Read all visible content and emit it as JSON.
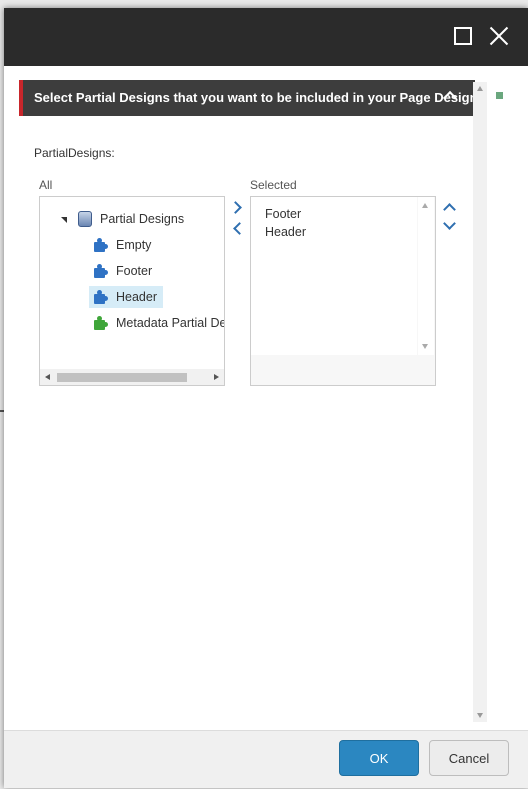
{
  "dialog": {
    "maximize_icon": "maximize-icon",
    "close_icon": "close-icon"
  },
  "section": {
    "title": "Select Partial Designs that you want to be included in your Page Design",
    "collapse_icon": "chevron-up-icon"
  },
  "field": {
    "label": "PartialDesigns:"
  },
  "all_panel": {
    "label": "All",
    "root": {
      "label": "Partial Designs",
      "icon": "database-icon",
      "expanded": true
    },
    "items": [
      {
        "label": "Empty",
        "icon": "puzzle-icon",
        "color": "#2f72c4"
      },
      {
        "label": "Footer",
        "icon": "puzzle-icon",
        "color": "#2f72c4"
      },
      {
        "label": "Header",
        "icon": "puzzle-icon",
        "color": "#2f72c4",
        "selected": true
      },
      {
        "label": "Metadata Partial De",
        "icon": "puzzle-icon",
        "color": "#3fa63a"
      }
    ]
  },
  "move_buttons": {
    "right_icon": "chevron-right-icon",
    "left_icon": "chevron-left-icon"
  },
  "selected_panel": {
    "label": "Selected",
    "items": [
      "Footer",
      "Header"
    ]
  },
  "order_buttons": {
    "up_icon": "chevron-up-icon",
    "down_icon": "chevron-down-icon"
  },
  "footer": {
    "ok_label": "OK",
    "cancel_label": "Cancel"
  },
  "colors": {
    "titlebar": "#2b2b2b",
    "accent": "#c8262b",
    "primary_button": "#2b87c1",
    "selection": "#d6ecf7"
  }
}
